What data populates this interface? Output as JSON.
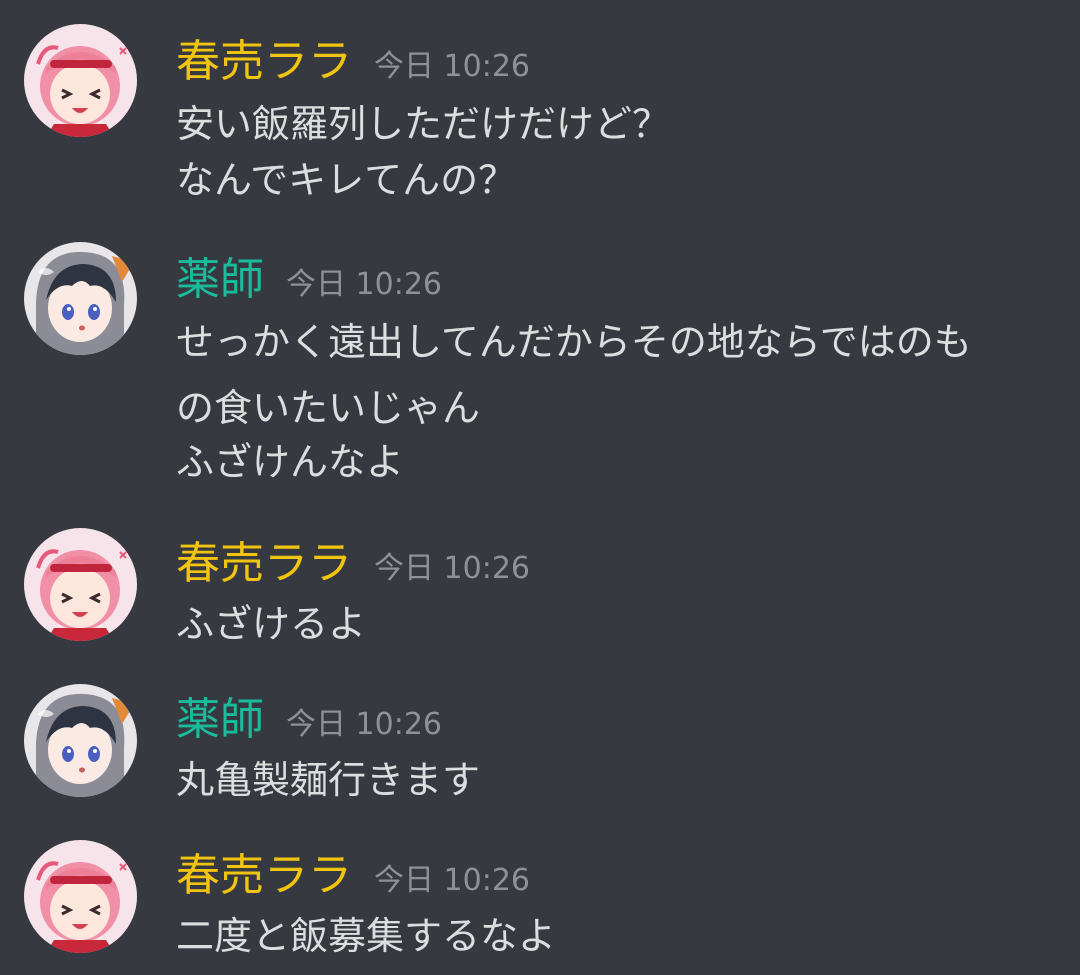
{
  "colors": {
    "background": "#36393f",
    "message_text": "#dcddde",
    "timestamp": "#8e9297",
    "user_haru": "#f1c40f",
    "user_yakushi": "#1abc9c"
  },
  "messages": [
    {
      "author": "春売ララ",
      "timestamp": "今日 10:26",
      "avatar_icon": "pink-hair-anime-girl-avatar",
      "lines": [
        "安い飯羅列しただけだけど？",
        "なんでキレてんの？"
      ]
    },
    {
      "author": "薬師",
      "timestamp": "今日 10:26",
      "avatar_icon": "dark-hair-hooded-anime-girl-avatar",
      "lines": [
        "せっかく遠出してんだからその地ならではのも",
        "の食いたいじゃん",
        "ふざけんなよ"
      ]
    },
    {
      "author": "春売ララ",
      "timestamp": "今日 10:26",
      "avatar_icon": "pink-hair-anime-girl-avatar",
      "lines": [
        "ふざけるよ"
      ]
    },
    {
      "author": "薬師",
      "timestamp": "今日 10:26",
      "avatar_icon": "dark-hair-hooded-anime-girl-avatar",
      "lines": [
        "丸亀製麺行きます"
      ]
    },
    {
      "author": "春売ララ",
      "timestamp": "今日 10:26",
      "avatar_icon": "pink-hair-anime-girl-avatar",
      "lines": [
        "二度と飯募集するなよ"
      ]
    }
  ]
}
